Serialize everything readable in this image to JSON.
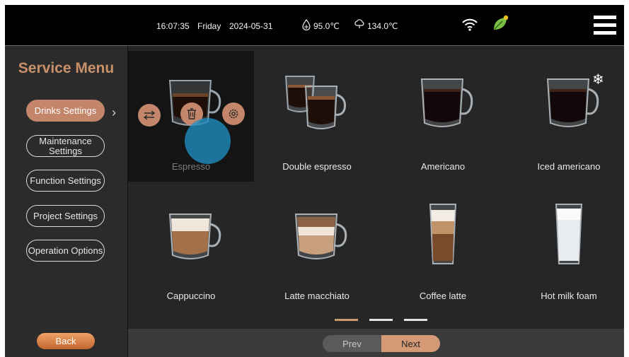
{
  "status_bar": {
    "time": "16:07:35",
    "day": "Friday",
    "date": "2024-05-31",
    "temp1": "95.0℃",
    "temp2": "134.0℃",
    "icons": [
      "water-drop-icon",
      "steam-cloud-icon",
      "wifi-icon",
      "eco-leaf-icon",
      "hamburger-menu-icon"
    ]
  },
  "sidebar": {
    "title": "Service Menu",
    "items": [
      {
        "label": "Drinks Settings",
        "active": true
      },
      {
        "label": "Maintenance Settings",
        "active": false
      },
      {
        "label": "Function Settings",
        "active": false
      },
      {
        "label": "Project Settings",
        "active": false
      },
      {
        "label": "Operation Options",
        "active": false
      }
    ],
    "back_label": "Back"
  },
  "drinks": [
    {
      "name": "Espresso",
      "selected": true
    },
    {
      "name": "Double espresso"
    },
    {
      "name": "Americano"
    },
    {
      "name": "Iced americano",
      "badge": "❄"
    },
    {
      "name": "Cappuccino"
    },
    {
      "name": "Latte macchiato"
    },
    {
      "name": "Coffee latte"
    },
    {
      "name": "Hot milk foam"
    }
  ],
  "overlay_actions": [
    "swap-icon",
    "delete-icon",
    "settings-icon"
  ],
  "pagination": {
    "pages": 3,
    "current": 1,
    "prev_label": "Prev",
    "next_label": "Next"
  },
  "colors": {
    "accent": "#c4866a",
    "touch_indicator": "#1f8fc4",
    "leaf": "#7ac043"
  }
}
